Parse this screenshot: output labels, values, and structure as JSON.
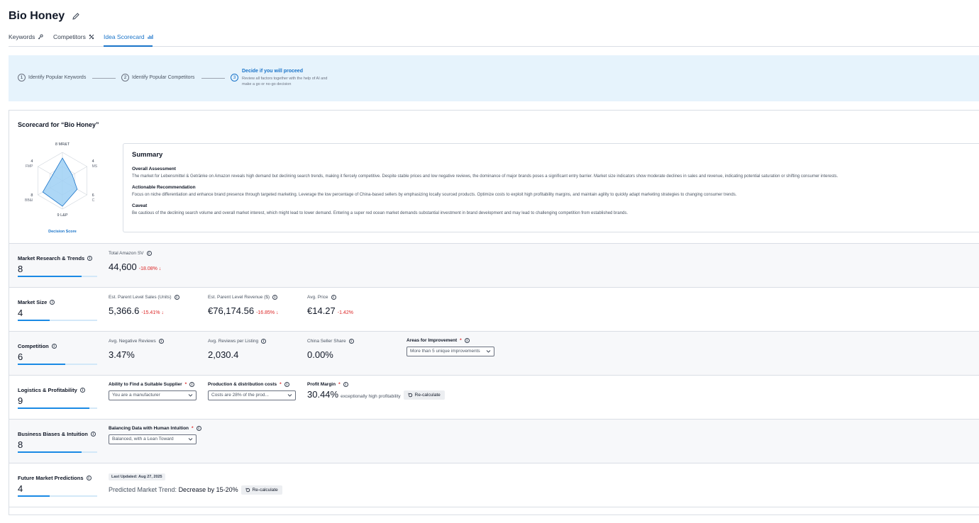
{
  "header": {
    "title": "Bio Honey"
  },
  "tabs": [
    {
      "label": "Keywords",
      "icon": "key-icon"
    },
    {
      "label": "Competitors",
      "icon": "swords-icon"
    },
    {
      "label": "Idea Scorecard",
      "icon": "scorecard-icon",
      "active": true
    }
  ],
  "steps": [
    {
      "num": "1",
      "label": "Identify Popular Keywords"
    },
    {
      "num": "2",
      "label": "Identify Popular Competitors"
    },
    {
      "num": "3",
      "label": "Decide if you will proceed",
      "desc": "Review all factors together with the help of AI and make a go or no-go decision"
    }
  ],
  "scorecard": {
    "title": "Scorecard for “Bio Honey”",
    "radar": {
      "caption": "Decision Score",
      "axes": [
        {
          "code": "MR&T",
          "score": 8
        },
        {
          "code": "MS",
          "score": 4
        },
        {
          "code": "C",
          "score": 6
        },
        {
          "code": "L&P",
          "score": 9
        },
        {
          "code": "BB&I",
          "score": 8
        },
        {
          "code": "FMP",
          "score": 4
        }
      ],
      "max": 10,
      "fill_color": "#9fd0f5",
      "stroke_color": "#1a74c9"
    },
    "summary": {
      "title": "Summary",
      "sections": [
        {
          "heading": "Overall Assessment",
          "text": "The market for Lebensmittel & Getränke on Amazon reveals high demand but declining search trends, making it fiercely competitive. Despite stable prices and low negative reviews, the dominance of major brands poses a significant entry barrier. Market size indicators show moderate declines in sales and revenue, indicating potential saturation or shifting consumer interests."
        },
        {
          "heading": "Actionable Recommendation",
          "text": "Focus on niche differentiation and enhance brand presence through targeted marketing. Leverage the low percentage of China-based sellers by emphasizing locally sourced products. Optimize costs to exploit high profitability margins, and maintain agility to quickly adapt marketing strategies to changing consumer trends."
        },
        {
          "heading": "Caveat",
          "text": "Be cautious of the declining search volume and overall market interest, which might lead to lower demand. Entering a super red ocean market demands substantial investment in brand development and may lead to challenging competition from established brands."
        }
      ]
    }
  },
  "rows": {
    "mrt": {
      "label": "Market Research & Trends",
      "score": "8",
      "score_value": 8,
      "sv_label": "Total Amazon SV",
      "sv_value": "44,600",
      "sv_delta": "-18.08%"
    },
    "ms": {
      "label": "Market Size",
      "score": "4",
      "score_value": 4,
      "units_label": "Est. Parent Level Sales (Units)",
      "units_value": "5,366.6",
      "units_delta": "-15.41%",
      "rev_label": "Est. Parent Level Revenue ($)",
      "rev_value": "€76,174.56",
      "rev_delta": "-16.85%",
      "price_label": "Avg. Price",
      "price_value": "€14.27",
      "price_delta": "-1.42%"
    },
    "comp": {
      "label": "Competition",
      "score": "6",
      "score_value": 6,
      "neg_label": "Avg. Negative Reviews",
      "neg_value": "3.47%",
      "rev_label": "Avg. Reviews per Listing",
      "rev_value": "2,030.4",
      "china_label": "China Seller Share",
      "china_value": "0.00%",
      "areas_label": "Areas for Improvement",
      "areas_value": "More than 5 unique improvements"
    },
    "lp": {
      "label": "Logistics & Profitability",
      "score": "9",
      "score_value": 9,
      "supplier_label": "Ability to Find a Suitable Supplier",
      "supplier_value": "You are a manufacturer",
      "costs_label": "Production & distribution costs",
      "costs_value": "Costs are 28% of the prod...",
      "margin_label": "Profit Margin",
      "margin_value": "30.44%",
      "margin_note": "exceptionally high profitability",
      "recalc": "Re-calculate"
    },
    "bbi": {
      "label": "Business Biases & Intuition",
      "score": "8",
      "score_value": 8,
      "balance_label": "Balancing Data with Human Intuition",
      "balance_value": "Balanced, with a Lean Toward"
    },
    "fmp": {
      "label": "Future Market Predictions",
      "score": "4",
      "score_value": 4,
      "updated": "Last Updated: Aug 27, 2025",
      "trend_label": "Predicted Market Trend:",
      "trend_value": "Decrease by 15-20%",
      "recalc": "Re-calculate"
    }
  }
}
